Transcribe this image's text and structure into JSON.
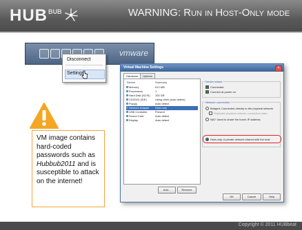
{
  "header": {
    "logo_text": "HUB",
    "logo_sup": "BUB",
    "title": "WARNING:  Run in Host-Only mode"
  },
  "taskbar": {
    "vmware_label": "vmware"
  },
  "context_menu": {
    "items": [
      "Disconnect",
      "Settings..."
    ]
  },
  "vm_window": {
    "title": "Virtual Machine Settings",
    "tabs": [
      "Hardware",
      "Options"
    ],
    "device_header": "Device",
    "summary_header": "Summary",
    "devices": [
      {
        "name": "Memory",
        "summary": "512 MB"
      },
      {
        "name": "Processors",
        "summary": "1"
      },
      {
        "name": "Hard Disk (SCSI)",
        "summary": "100 GB"
      },
      {
        "name": "CD/DVD (IDE)",
        "summary": "Using drive (auto detect)"
      },
      {
        "name": "Floppy",
        "summary": "Auto detect"
      },
      {
        "name": "Network Adapter",
        "summary": "Host-only"
      },
      {
        "name": "USB Controller",
        "summary": "Present"
      },
      {
        "name": "Sound Card",
        "summary": "Auto detect"
      },
      {
        "name": "Display",
        "summary": "Auto detect"
      }
    ],
    "selected_device_index": 5,
    "device_status_title": "Device status",
    "status_options": [
      "Connected",
      "Connect at power on"
    ],
    "network_title": "Network connection",
    "network_options": [
      "Bridged: Connected directly to the physical network",
      "Replicate physical network connection state",
      "NAT: Used to share the host's IP address",
      "Host-only: A private network shared with the host"
    ],
    "selected_network_index": 3,
    "buttons": {
      "add": "Add...",
      "remove": "Remove",
      "ok": "OK",
      "cancel": "Cancel",
      "help": "Help"
    }
  },
  "warning": {
    "line1": "VM image contains hard-coded passwords such as ",
    "password": "Hubbub2011",
    "line2": " and is susceptible to attack on the internet!"
  },
  "footer": {
    "copyright": "Copyright © 2011 HUBbeat"
  },
  "colors": {
    "warning_border": "#f2a33a",
    "warning_icon": "#f5a623",
    "highlight_ring": "#dd2222",
    "title_bar": "#3a6296"
  }
}
